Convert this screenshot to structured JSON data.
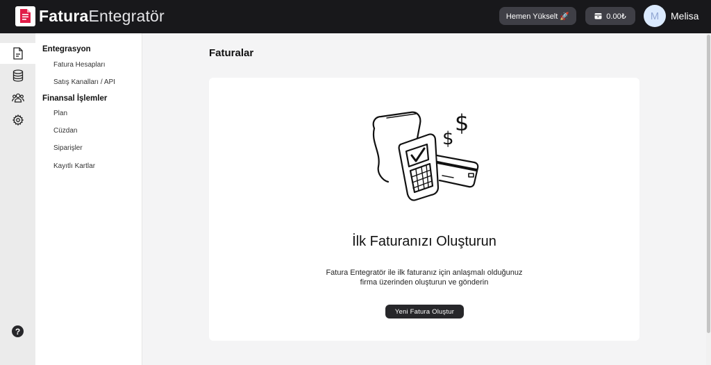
{
  "header": {
    "brand_bold": "Fatura",
    "brand_light": "Entegratör",
    "upgrade_label": "Hemen Yükselt 🚀",
    "balance": "0.00₺",
    "avatar_initial": "M",
    "user_name": "Melisa"
  },
  "rail": {
    "icons": [
      "document-icon",
      "database-icon",
      "users-icon",
      "gear-icon"
    ],
    "active_index": 0,
    "help": "?"
  },
  "nav": {
    "groups": [
      {
        "title": "Entegrasyon",
        "items": [
          "Fatura Hesapları",
          "Satış Kanalları / API"
        ]
      },
      {
        "title": "Finansal İşlemler",
        "items": [
          "Plan",
          "Cüzdan",
          "Siparişler",
          "Kayıtlı Kartlar"
        ]
      }
    ]
  },
  "main": {
    "page_title": "Faturalar",
    "empty_title": "İlk Faturanızı Oluşturun",
    "empty_desc_line1": "Fatura Entegratör ile ilk faturanız için anlaşmalı olduğunuz",
    "empty_desc_line2": "firma üzerinden oluşturun ve gönderin",
    "create_button": "Yeni Fatura Oluştur"
  },
  "colors": {
    "topbar": "#18181b",
    "brand_red": "#e11d48",
    "button_dark": "#27272a",
    "pill": "#3f3f46",
    "avatar_bg": "#dbeafe"
  }
}
